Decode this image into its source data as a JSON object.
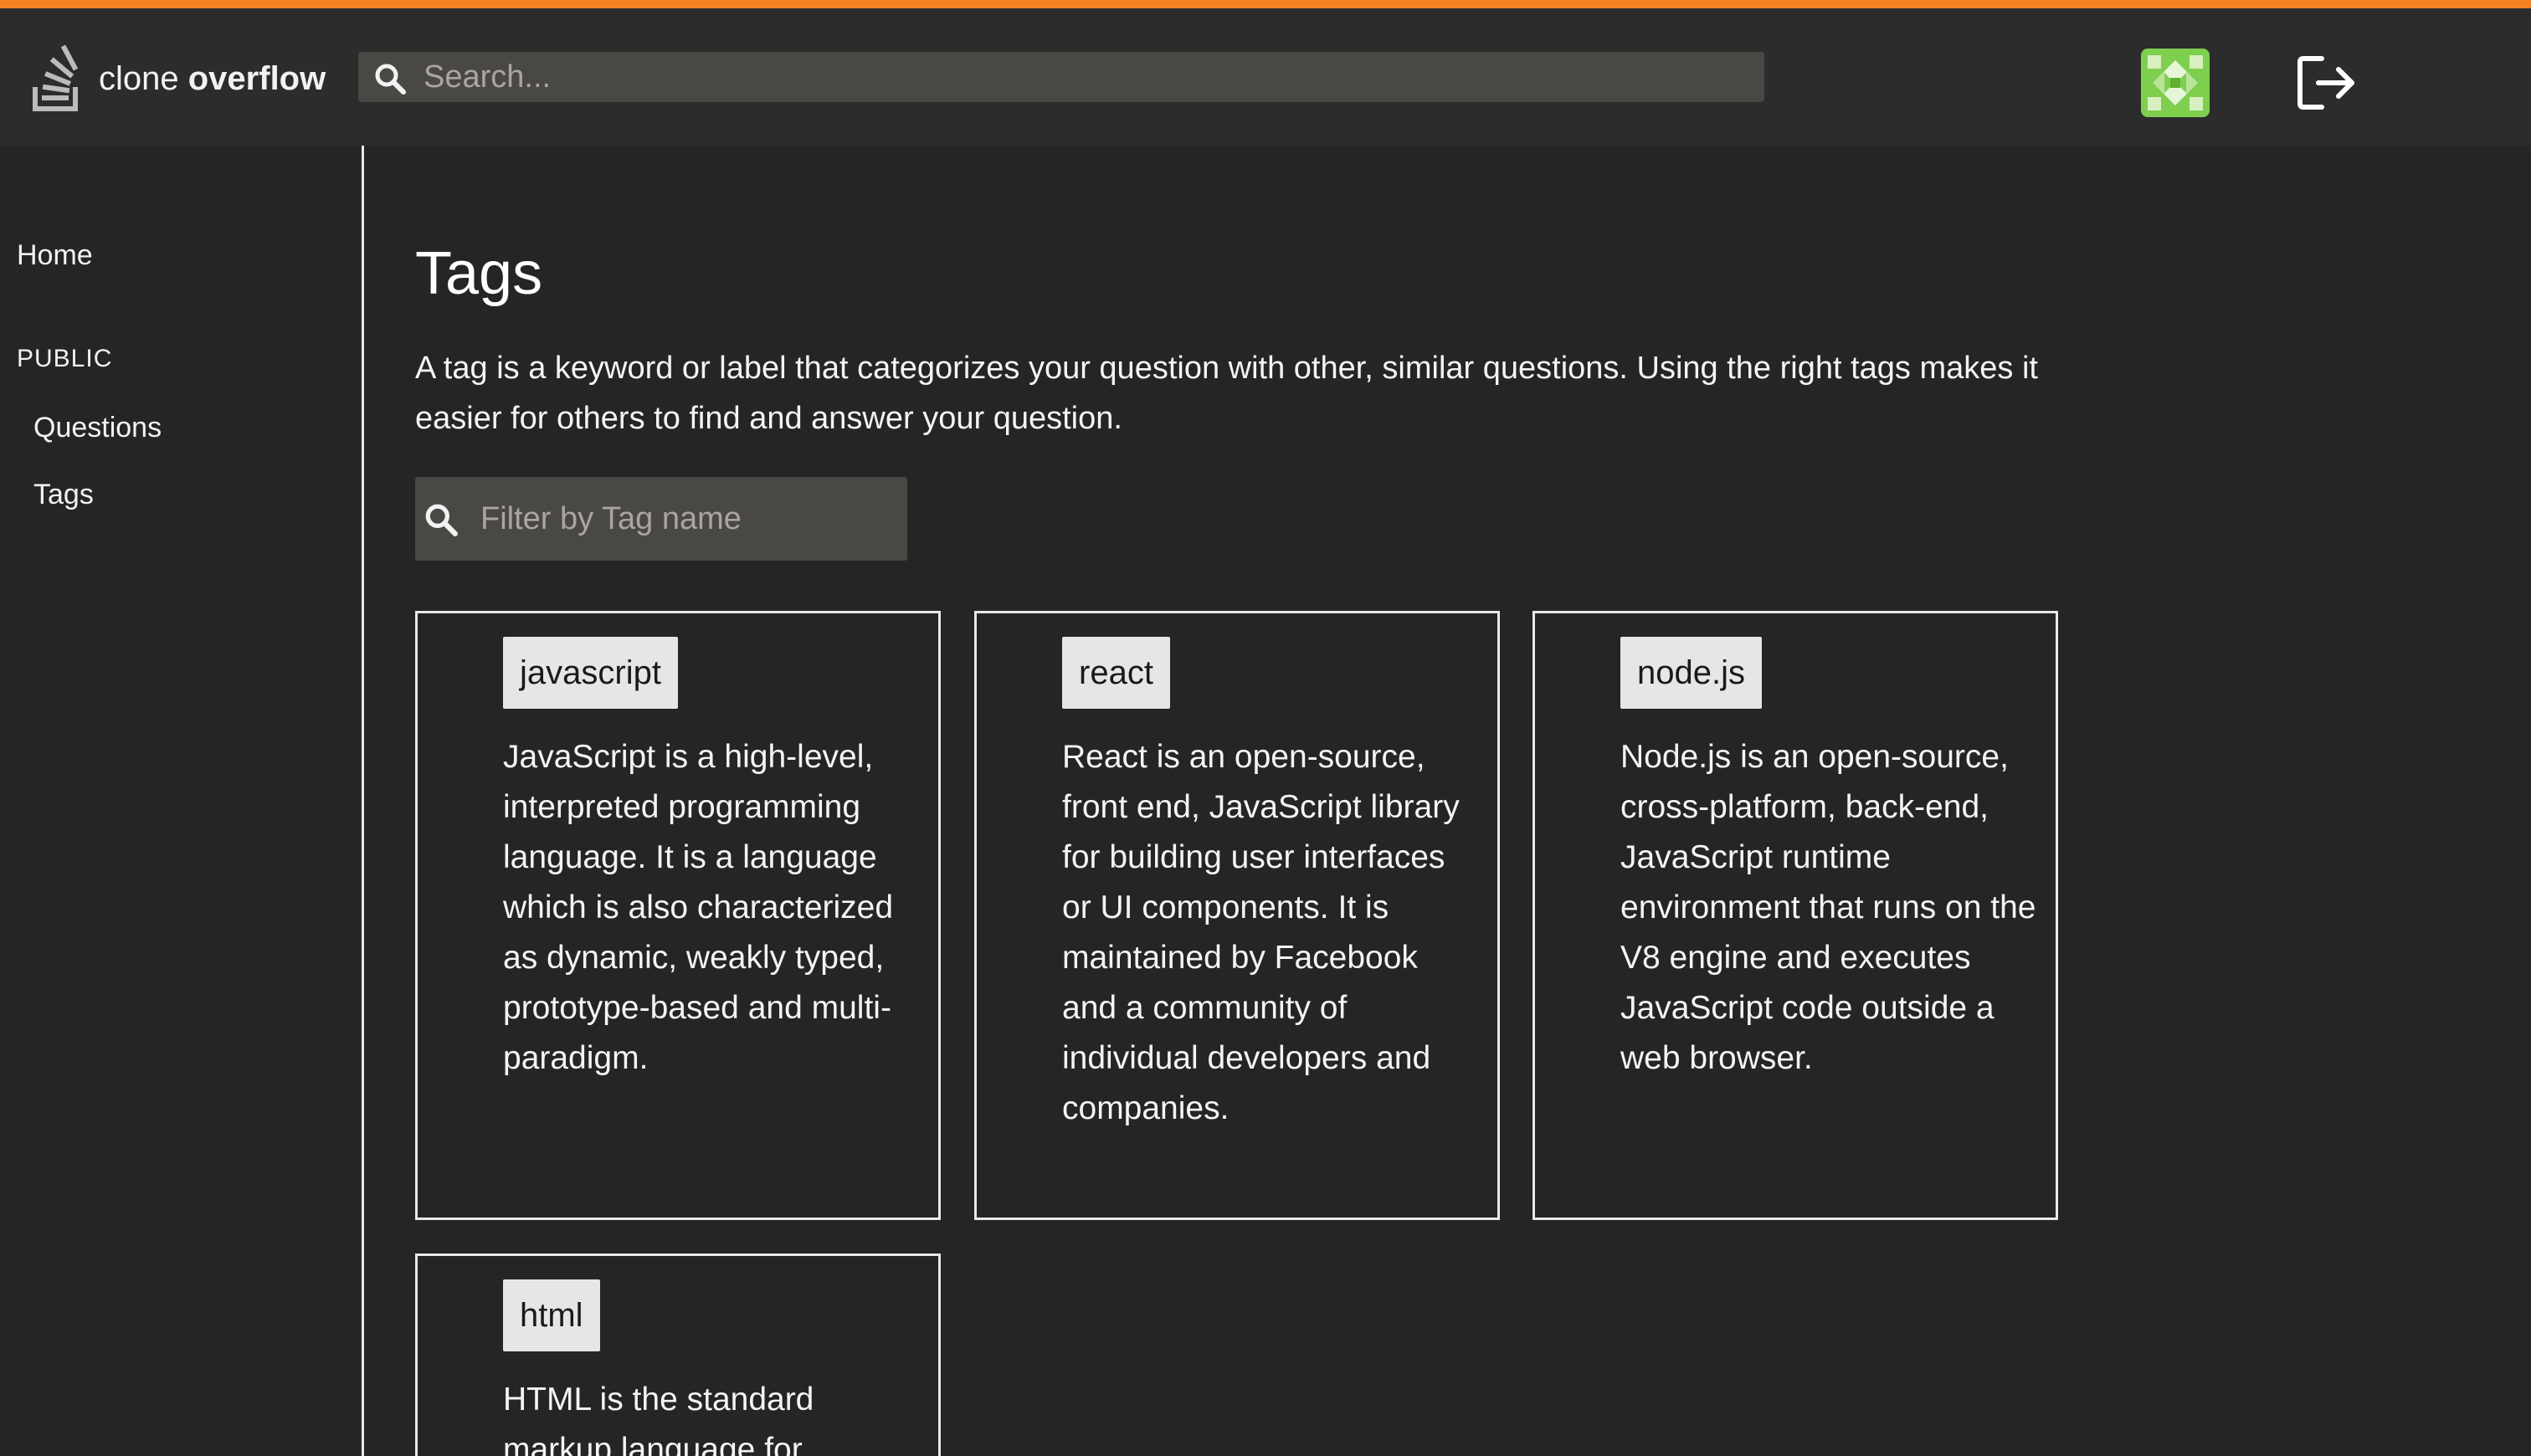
{
  "app": {
    "logo_light": "clone ",
    "logo_bold": "overflow",
    "accent_color": "#f48024"
  },
  "header": {
    "search_placeholder": "Search...",
    "avatar_icon": "avatar-identicon",
    "logout_icon": "logout-icon"
  },
  "sidebar": {
    "home": "Home",
    "public_heading": "PUBLIC",
    "items": [
      {
        "label": "Questions"
      },
      {
        "label": "Tags"
      }
    ]
  },
  "main": {
    "title": "Tags",
    "intro": "A tag is a keyword or label that categorizes your question with other, similar questions. Using the right tags makes it easier for others to find and answer your question.",
    "filter_placeholder": "Filter by Tag name",
    "tags": [
      {
        "name": "javascript",
        "description": "JavaScript is a high-level, interpreted programming language. It is a language which is also characterized as dynamic, weakly typed, prototype-based and multi-paradigm."
      },
      {
        "name": "react",
        "description": "React is an open-source, front end, JavaScript library for building user interfaces or UI components. It is maintained by Facebook and a community of individual developers and companies."
      },
      {
        "name": "node.js",
        "description": "Node.js is an open-source, cross-platform, back-end, JavaScript runtime environment that runs on the V8 engine and executes JavaScript code outside a web browser."
      },
      {
        "name": "html",
        "description": "HTML is the standard markup language for"
      }
    ]
  }
}
